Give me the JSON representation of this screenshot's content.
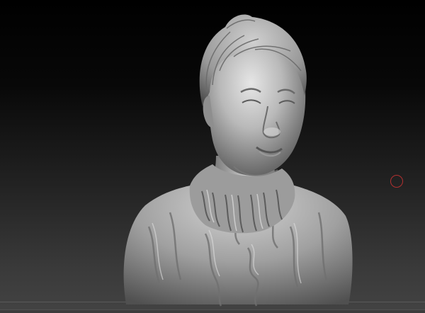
{
  "viewport": {
    "background_top": "#000000",
    "background_bottom": "#434343",
    "model_material": "#bfbfbf",
    "model_shadow": "#4a4a4a",
    "brush_cursor_color": "#b23030"
  },
  "icons": {
    "brush_cursor": "brush-cursor-icon"
  }
}
